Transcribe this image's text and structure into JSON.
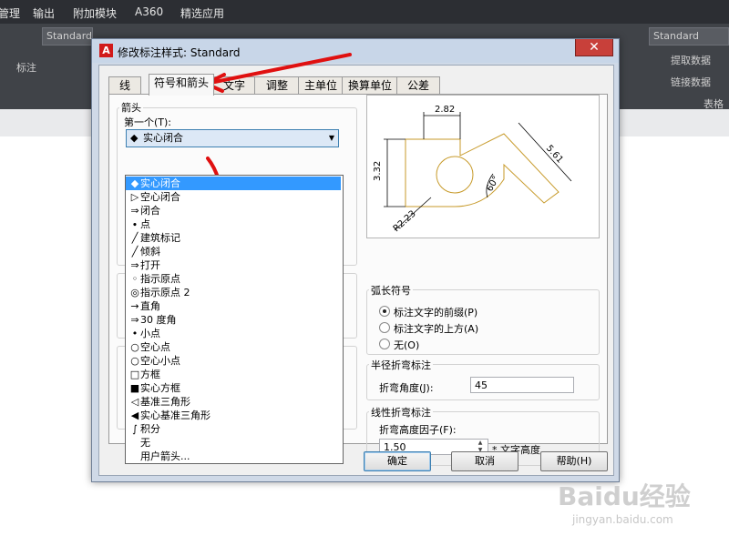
{
  "menubar": {
    "items": [
      "管理",
      "输出",
      "附加模块",
      "A360",
      "精选应用"
    ]
  },
  "ribbon": {
    "left_dropdown": "Standard",
    "left_label": "标注",
    "right_dropdown": "Standard",
    "right_label1": "提取数据",
    "right_label2": "链接数据",
    "right_section": "表格"
  },
  "dialog": {
    "title": "修改标注样式: Standard",
    "close": "✕",
    "tabs": [
      "线",
      "符号和箭头",
      "文字",
      "调整",
      "主单位",
      "换算单位",
      "公差"
    ],
    "arrows_group": "箭头",
    "first_label": "第一个(T):",
    "first_value": "实心闭合",
    "dropdown_items": [
      {
        "icon": "◆",
        "label": "实心闭合"
      },
      {
        "icon": "▷",
        "label": "空心闭合"
      },
      {
        "icon": "⇒",
        "label": "闭合"
      },
      {
        "icon": "∙",
        "label": "点"
      },
      {
        "icon": "╱",
        "label": "建筑标记"
      },
      {
        "icon": "╱",
        "label": "倾斜"
      },
      {
        "icon": "⇒",
        "label": "打开"
      },
      {
        "icon": "◦",
        "label": "指示原点"
      },
      {
        "icon": "◎",
        "label": "指示原点 2"
      },
      {
        "icon": "→",
        "label": "直角"
      },
      {
        "icon": "⇒",
        "label": "30 度角"
      },
      {
        "icon": "•",
        "label": "小点"
      },
      {
        "icon": "○",
        "label": "空心点"
      },
      {
        "icon": "○",
        "label": "空心小点"
      },
      {
        "icon": "□",
        "label": "方框"
      },
      {
        "icon": "■",
        "label": "实心方框"
      },
      {
        "icon": "◁",
        "label": "基准三角形"
      },
      {
        "icon": "◀",
        "label": "实心基准三角形"
      },
      {
        "icon": "∫",
        "label": "积分"
      },
      {
        "icon": "",
        "label": "无"
      },
      {
        "icon": "",
        "label": "用户箭头..."
      }
    ],
    "arc_group": "弧长符号",
    "arc_options": [
      "标注文字的前缀(P)",
      "标注文字的上方(A)",
      "无(O)"
    ],
    "radius_group": "半径折弯标注",
    "radius_label": "折弯角度(J):",
    "radius_value": "45",
    "linear_group": "线性折弯标注",
    "linear_label": "折弯高度因子(F):",
    "linear_value": "1.50",
    "linear_unit": "* 文字高度",
    "ok": "确定",
    "cancel": "取消",
    "help": "帮助(H)"
  },
  "preview": {
    "dim_top": "2.82",
    "dim_left": "3.32",
    "dim_right": "5.61",
    "dim_angle": "60°",
    "dim_radius": "R2.23"
  },
  "annotation_color": "#e01010",
  "watermark": {
    "logo": "Baidu经验",
    "url": "jingyan.baidu.com"
  }
}
